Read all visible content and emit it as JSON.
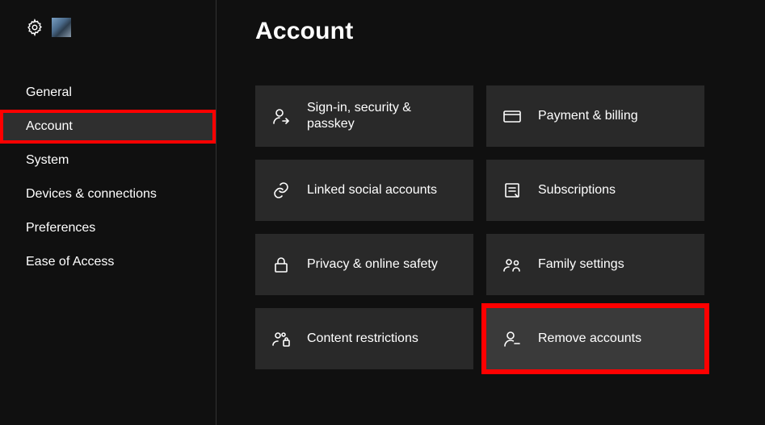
{
  "page": {
    "title": "Account"
  },
  "sidebar": {
    "items": [
      {
        "label": "General"
      },
      {
        "label": "Account"
      },
      {
        "label": "System"
      },
      {
        "label": "Devices & connections"
      },
      {
        "label": "Preferences"
      },
      {
        "label": "Ease of Access"
      }
    ],
    "selected_index": 1,
    "highlight_index": 1
  },
  "tiles": [
    {
      "label": "Sign-in, security & passkey",
      "icon": "person-arrow-icon"
    },
    {
      "label": "Payment & billing",
      "icon": "credit-card-icon"
    },
    {
      "label": "Linked social accounts",
      "icon": "link-icon"
    },
    {
      "label": "Subscriptions",
      "icon": "receipt-icon"
    },
    {
      "label": "Privacy & online safety",
      "icon": "lock-icon"
    },
    {
      "label": "Family settings",
      "icon": "people-icon"
    },
    {
      "label": "Content restrictions",
      "icon": "people-lock-icon"
    },
    {
      "label": "Remove accounts",
      "icon": "person-remove-icon"
    }
  ],
  "highlight_tile_index": 7
}
